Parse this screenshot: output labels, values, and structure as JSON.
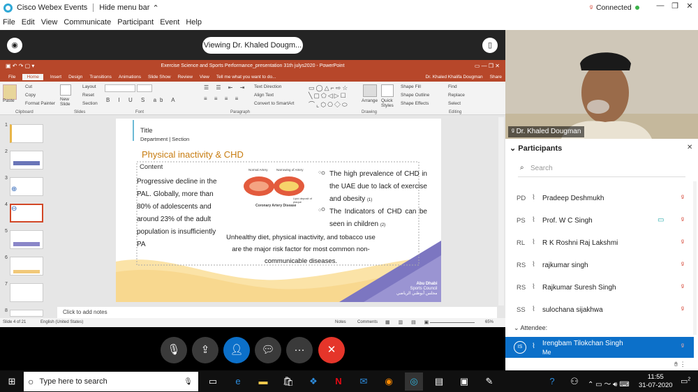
{
  "titlebar": {
    "app": "Cisco Webex Events",
    "hide_menu": "Hide menu bar",
    "status": "Connected"
  },
  "menu": [
    "File",
    "Edit",
    "View",
    "Communicate",
    "Participant",
    "Event",
    "Help"
  ],
  "viewing": "Viewing Dr. Khaled Dougm...",
  "ppt": {
    "title": "Exercise Science and Sports Performance_presentation 31th julys2020 - PowerPoint",
    "user": "Dr. Khaled Khalifa Dougman",
    "share": "Share",
    "tell_me": "Tell me what you want to do...",
    "tabs": [
      "File",
      "Home",
      "Insert",
      "Design",
      "Transitions",
      "Animations",
      "Slide Show",
      "Review",
      "View"
    ],
    "groups": [
      "Clipboard",
      "Slides",
      "Font",
      "Paragraph",
      "Drawing",
      "Editing"
    ],
    "clipboard": [
      "Paste",
      "Cut",
      "Copy",
      "Format Painter"
    ],
    "slides": [
      "New Slide",
      "Layout",
      "Reset",
      "Section"
    ],
    "paragraph": [
      "Text Direction",
      "Align Text",
      "Convert to SmartArt"
    ],
    "drawing": [
      "Arrange",
      "Quick Styles",
      "Shape Fill",
      "Shape Outline",
      "Shape Effects"
    ],
    "editing": [
      "Find",
      "Replace",
      "Select"
    ],
    "thumb_numbers": [
      "1",
      "2",
      "3",
      "4",
      "5",
      "6",
      "7",
      "8"
    ],
    "notes": "Click to add notes",
    "status_left": "Slide 4 of 21",
    "status_lang": "English (United States)",
    "status_notes": "Notes",
    "status_comments": "Comments",
    "zoom": "65%"
  },
  "slide": {
    "title": "Title",
    "subtitle": "Department | Section",
    "heading": "Physical inactivity & CHD",
    "content_label": "Content",
    "left_text": "Progressive decline in the PAL. Globally, more than 80% of adolescents and around 23% of the adult population is insufficiently PA",
    "artery_normal": "Normal Artery",
    "artery_narrow": "Narrowing of Artery",
    "artery_plaque": "Lipid deposit of plaque",
    "artery_caption": "Coronary Artery Disease",
    "bullet1_a": "The high prevalence of CHD in the UAE due to lack of exercise and obesity",
    "bullet1_ref": "(1)",
    "bullet2_a": "The Indicators of CHD can be seen in children",
    "bullet2_ref": "(2)",
    "bottom_text": "Unhealthy diet, physical inactivity, and tobacco use are the major risk factor for most common non-communicable diseases.",
    "logo_line1": "Abu Dhabi",
    "logo_line2": "Sports Council",
    "logo_line3": "مجلس أبوظبي الرياضي"
  },
  "video": {
    "name": "Dr. Khaled Dougman"
  },
  "participants": {
    "header": "Participants",
    "search_placeholder": "Search",
    "attendee_label": "Attendee:",
    "rows": [
      {
        "init": "PD",
        "name": "Pradeep Deshmukh",
        "video": false
      },
      {
        "init": "PS",
        "name": "Prof. W C Singh",
        "video": true
      },
      {
        "init": "RL",
        "name": "R K Roshni Raj Lakshmi",
        "video": false
      },
      {
        "init": "RS",
        "name": "rajkumar singh",
        "video": false
      },
      {
        "init": "RS",
        "name": "Rajkumar Suresh Singh",
        "video": false
      },
      {
        "init": "SS",
        "name": "sulochana sijakhwa",
        "video": false
      }
    ],
    "self": {
      "init": "IS",
      "name": "Irengbam Tilokchan Singh",
      "sub": "Me"
    }
  },
  "taskbar": {
    "search": "Type here to search",
    "time": "11:55",
    "date": "31-07-2020",
    "notif": "2"
  },
  "colors": {
    "ppt_accent": "#b7472a",
    "webex_blue": "#0c70c9",
    "end_red": "#e5352a",
    "slide_title": "#c77c10"
  }
}
